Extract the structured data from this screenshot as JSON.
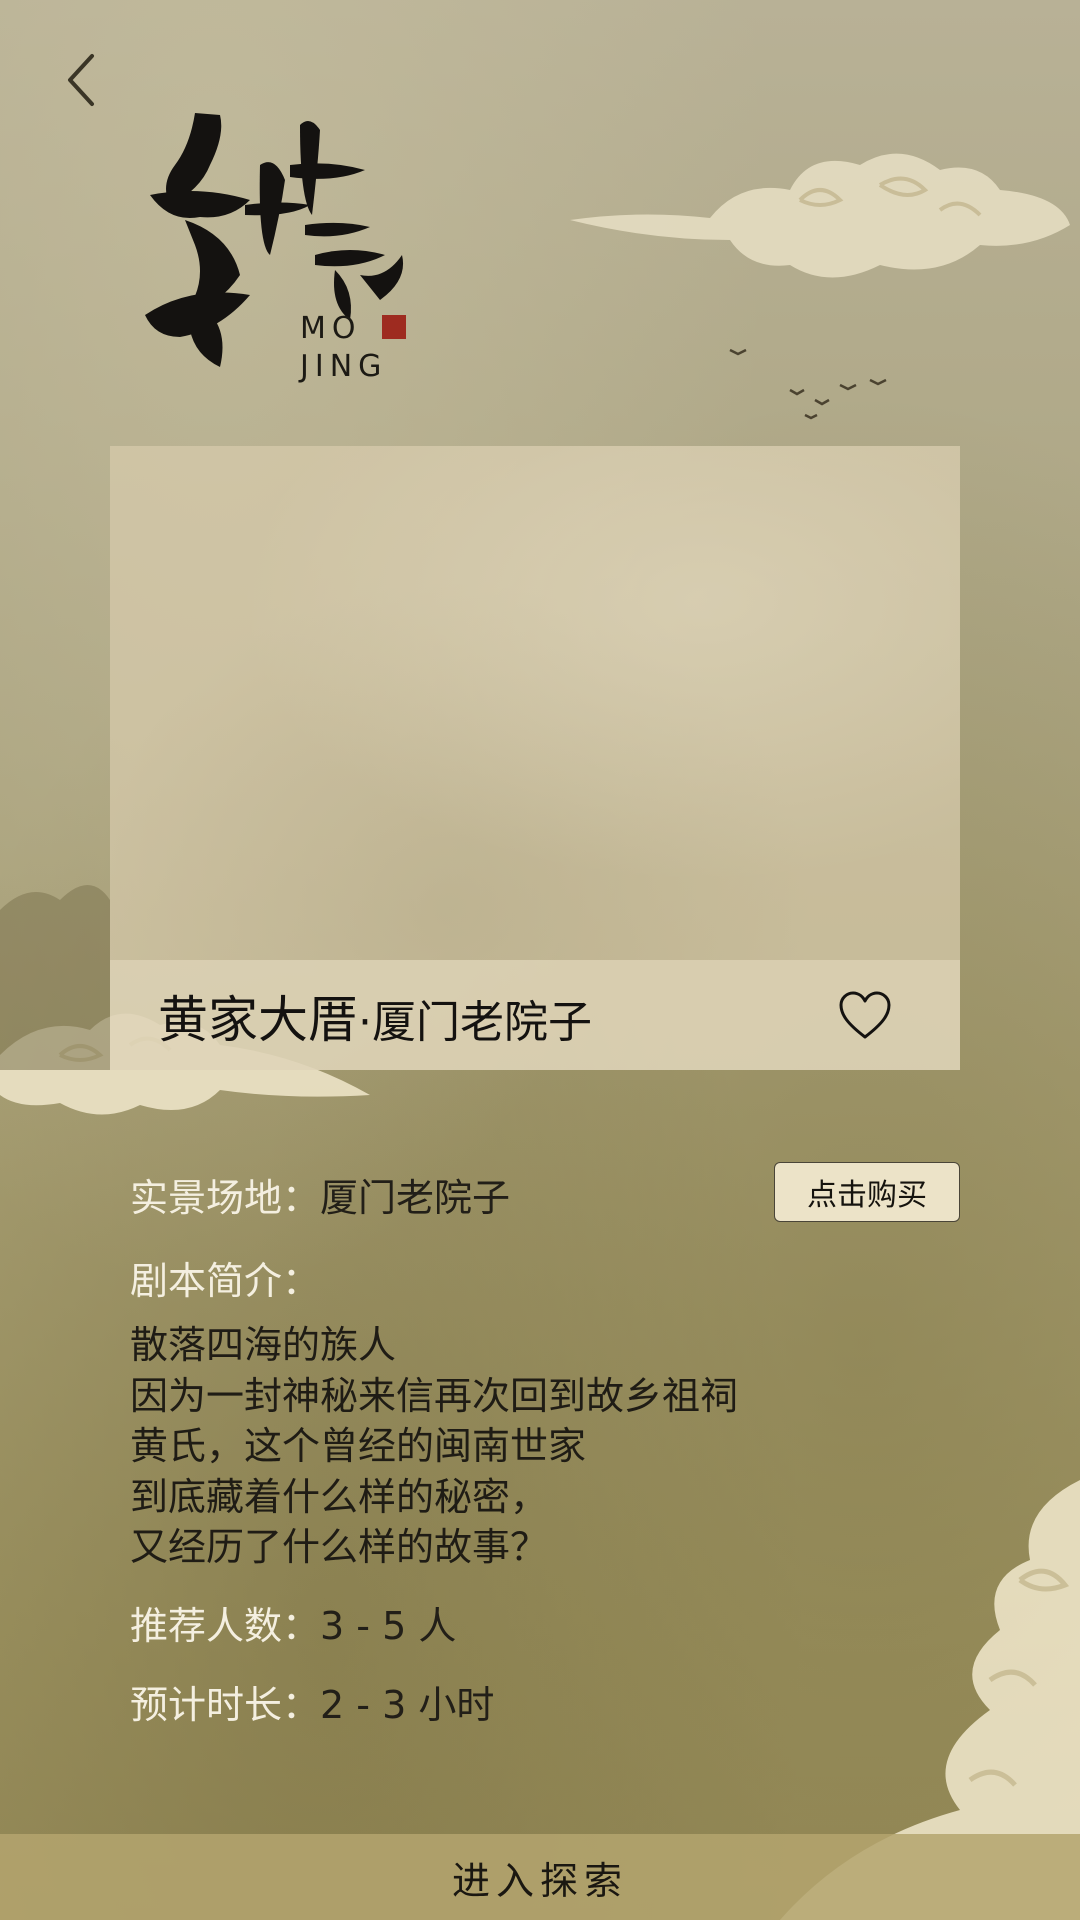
{
  "app": {
    "logo_text": "墨境",
    "logo_latin_line1": "MO",
    "logo_latin_line2": "JING"
  },
  "header": {
    "back_icon": "chevron-left-icon"
  },
  "card": {
    "title_main": "黄家大厝",
    "title_sep": "·",
    "title_sub": "厦门老院子",
    "favorite_icon": "heart-outline-icon"
  },
  "info": {
    "venue_label": "实景场地：",
    "venue_value": "厦门老院子",
    "buy_label": "点击购买",
    "synopsis_label": "剧本简介：",
    "synopsis_lines": [
      "散落四海的族人",
      "因为一封神秘来信再次回到故乡祖祠",
      "黄氏，这个曾经的闽南世家",
      "到底藏着什么样的秘密，",
      "又经历了什么样的故事？"
    ],
    "players_label": "推荐人数：",
    "players_value": "3 - 5 人",
    "duration_label": "预计时长：",
    "duration_value": "2 - 3 小时"
  },
  "footer": {
    "enter_label": "进入探索"
  },
  "colors": {
    "accent_bar": "#b4a46e",
    "button_bg": "#ece3c8",
    "label_text": "#f4efe0",
    "value_text": "#221f18"
  }
}
